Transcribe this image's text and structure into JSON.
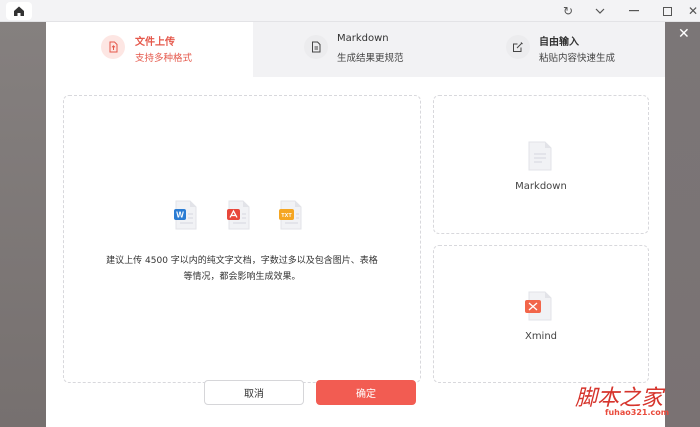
{
  "tabs": [
    {
      "title": "文件上传",
      "subtitle": "支持多种格式",
      "icon": "upload-file-icon"
    },
    {
      "title": "Markdown",
      "subtitle": "生成结果更规范",
      "icon": "markdown-doc-icon"
    },
    {
      "title": "自由输入",
      "subtitle": "粘贴内容快速生成",
      "icon": "edit-icon"
    }
  ],
  "upload": {
    "hint_line1": "建议上传 4500 字以内的纯文字文档，字数过多以及包含图片、表格",
    "hint_line2": "等情况，都会影响生成效果。",
    "file_types": [
      "W",
      "PDF",
      "TXT"
    ]
  },
  "options": {
    "markdown_label": "Markdown",
    "xmind_label": "Xmind"
  },
  "buttons": {
    "cancel": "取消",
    "confirm": "确定"
  },
  "watermark": {
    "text": "脚本之家",
    "url": "fuhao321.com"
  },
  "colors": {
    "accent": "#f25c52",
    "word": "#2b7cd3",
    "pdf": "#e8473b",
    "txt": "#f5a623"
  }
}
